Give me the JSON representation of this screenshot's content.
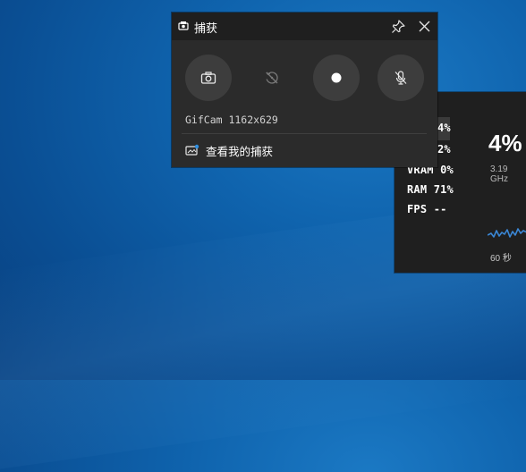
{
  "capture_widget": {
    "title": "捕获",
    "info": "GifCam 1162x629",
    "view_captures": "查看我的捕获",
    "buttons": {
      "screenshot_icon": "camera-icon",
      "record_last_icon": "record-last-30s-icon",
      "record_icon": "record-dot-icon",
      "mic_icon": "mic-off-icon"
    }
  },
  "performance_widget": {
    "rows": [
      {
        "label": "4%"
      },
      {
        "label": "2%"
      },
      {
        "label": "VRAM  0%"
      },
      {
        "label": "RAM  71%"
      },
      {
        "label": "FPS --"
      }
    ],
    "big_value": "4%",
    "clock": "3.19 GHz",
    "timespan": "60 秒"
  },
  "colors": {
    "desktop": "#0f63ad",
    "panel": "#2b2b2b",
    "panel_header": "#1f1f1f",
    "sparkline": "#3a86d4"
  }
}
